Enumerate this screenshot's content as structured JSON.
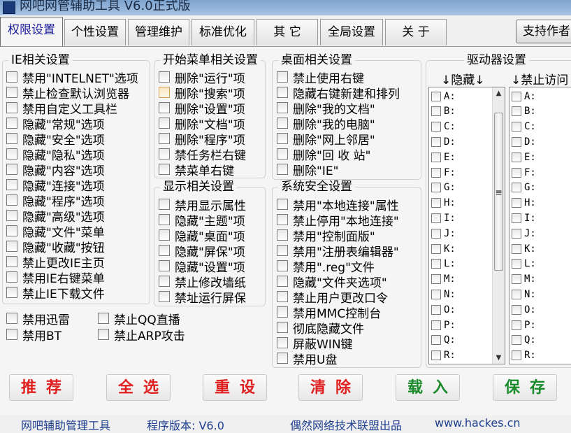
{
  "window": {
    "title": "网吧网管辅助工具 V6.0正式版"
  },
  "tabs": [
    {
      "label": "权限设置",
      "active": true
    },
    {
      "label": "个性设置"
    },
    {
      "label": "管理维护"
    },
    {
      "label": "标准优化"
    },
    {
      "label": "其  它"
    },
    {
      "label": "全局设置"
    },
    {
      "label": "关  于"
    }
  ],
  "support_button": "支持作者",
  "ie_group": {
    "title": "IE相关设置",
    "items": [
      "禁用\"INTELNET\"选项",
      "禁止检查默认浏览器",
      "禁用自定义工具栏",
      "隐藏\"常规\"选项",
      "隐藏\"安全\"选项",
      "隐藏\"隐私\"选项",
      "隐藏\"内容\"选项",
      "隐藏\"连接\"选项",
      "隐藏\"程序\"选项",
      "隐藏\"高级\"选项",
      "隐藏\"文件\"菜单",
      "隐藏\"收藏\"按钮",
      "禁止更改IE主页",
      "禁用IE右键菜单",
      "禁止IE下载文件"
    ]
  },
  "extra_items": [
    "禁用迅雷",
    "禁止QQ直播",
    "禁用BT",
    "禁止ARP攻击"
  ],
  "start_group": {
    "title": "开始菜单相关设置",
    "items": [
      "删除\"运行\"项",
      "删除\"搜索\"项",
      "删除\"设置\"项",
      "删除\"文档\"项",
      "删除\"程序\"项",
      "禁任务栏右键",
      "禁菜单右键"
    ]
  },
  "display_group": {
    "title": "显示相关设置",
    "items": [
      "禁用显示属性",
      "隐藏\"主题\"项",
      "隐藏\"桌面\"项",
      "隐藏\"屏保\"项",
      "隐藏\"设置\"项",
      "禁止修改墙纸",
      "禁址运行屏保"
    ]
  },
  "desktop_group": {
    "title": "桌面相关设置",
    "items": [
      "禁止使用右键",
      "隐藏右键新建和排列",
      "删除\"我的文档\"",
      "删除\"我的电脑\"",
      "删除\"网上邻居\"",
      "删除\"回 收 站\"",
      "删除\"IE\""
    ]
  },
  "security_group": {
    "title": "系统安全设置",
    "items": [
      "禁用\"本地连接\"属性",
      "禁止停用\"本地连接\"",
      "禁用\"控制面版\"",
      "禁用\"注册表编辑器\"",
      "禁用\".reg\"文件",
      "隐藏\"文件夹选项\"",
      "禁止用户更改口令",
      "禁用MMC控制台",
      "彻底隐藏文件",
      "屏蔽WIN键",
      "禁用U盘"
    ]
  },
  "drive_group": {
    "title": "驱动器设置",
    "hide_label": "↓隐藏↓",
    "deny_label": "↓禁止访问↓",
    "drives": [
      "A:",
      "B:",
      "C:",
      "D:",
      "E:",
      "F:",
      "G:",
      "H:",
      "I:",
      "J:",
      "K:",
      "L:",
      "M:",
      "N:",
      "O:",
      "P:",
      "Q:",
      "R:"
    ]
  },
  "actions": [
    {
      "label": "推荐",
      "color": "#e02020"
    },
    {
      "label": "全选",
      "color": "#e02020"
    },
    {
      "label": "重设",
      "color": "#e02020"
    },
    {
      "label": "清除",
      "color": "#e02020"
    },
    {
      "label": "载入",
      "color": "#1a8a2a"
    },
    {
      "label": "保存",
      "color": "#1a8a2a"
    }
  ],
  "status": {
    "app": "网吧辅助管理工具",
    "version": "程序版本: V6.0",
    "publisher": "偶然网络技术联盟出品",
    "url": "www.hackes.cn"
  }
}
